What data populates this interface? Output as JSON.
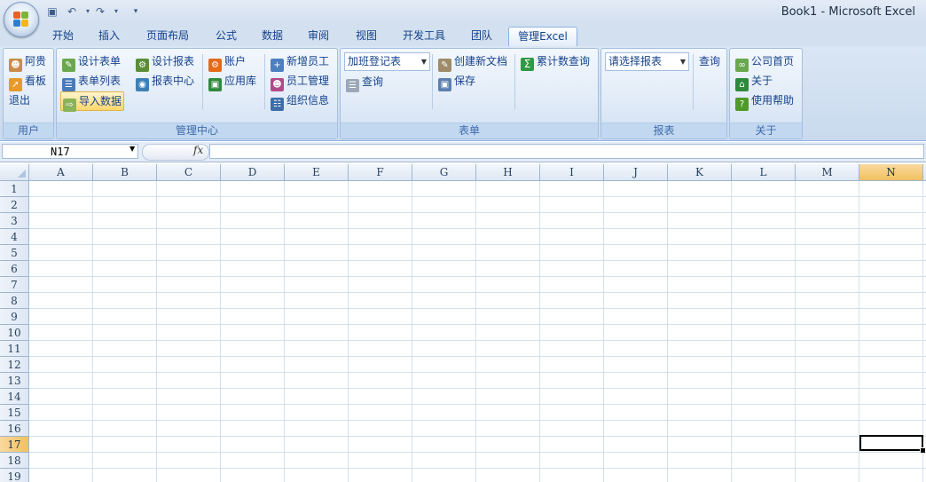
{
  "window": {
    "title": "Book1 - Microsoft Excel"
  },
  "qat": {
    "icons": [
      "save-icon",
      "undo-icon",
      "redo-icon",
      "customize-icon"
    ]
  },
  "tabs": [
    {
      "label": "开始"
    },
    {
      "label": "插入"
    },
    {
      "label": "页面布局"
    },
    {
      "label": "公式"
    },
    {
      "label": "数据"
    },
    {
      "label": "审阅"
    },
    {
      "label": "视图"
    },
    {
      "label": "开发工具"
    },
    {
      "label": "团队"
    },
    {
      "label": "管理Excel",
      "active": true
    }
  ],
  "ribbon": {
    "user": {
      "label": "用户",
      "items": [
        "阿贵",
        "看板",
        "退出"
      ]
    },
    "manage": {
      "label": "管理中心",
      "col1": [
        "设计表单",
        "表单列表",
        "导入数据"
      ],
      "col2": [
        "设计报表",
        "报表中心"
      ],
      "col3": [
        "账户",
        "应用库"
      ],
      "col4": [
        "新增员工",
        "员工管理",
        "组织信息"
      ]
    },
    "form": {
      "label": "表单",
      "combo_value": "加班登记表",
      "query": "查询",
      "create_doc": "创建新文档",
      "save": "保存",
      "cumulative_query": "累计数查询"
    },
    "report": {
      "label": "报表",
      "combo_value": "请选择报表",
      "query": "查询"
    },
    "about": {
      "label": "关于",
      "items": [
        "公司首页",
        "关于",
        "使用帮助"
      ]
    }
  },
  "formula_bar": {
    "name_box": "N17",
    "fx": "fx",
    "formula": ""
  },
  "grid": {
    "columns": [
      "A",
      "B",
      "C",
      "D",
      "E",
      "F",
      "G",
      "H",
      "I",
      "J",
      "K",
      "L",
      "M",
      "N"
    ],
    "rows": [
      "1",
      "2",
      "3",
      "4",
      "5",
      "6",
      "7",
      "8",
      "9",
      "10",
      "11",
      "12",
      "13",
      "14",
      "15",
      "16",
      "17",
      "18",
      "19"
    ],
    "selected_column": "N",
    "selected_row": "17"
  },
  "colors": {
    "accent": "#f1c15f",
    "ribbon": "#dae6f4",
    "text": "#15428b"
  }
}
